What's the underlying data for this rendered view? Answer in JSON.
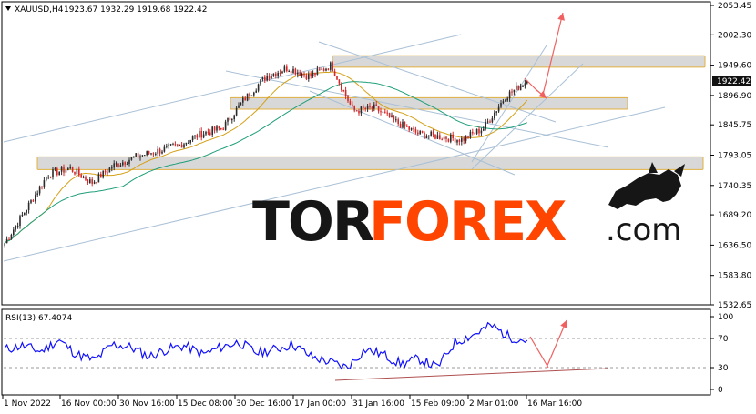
{
  "header": {
    "symbol_label": "XAUUSD,H4",
    "ohlc_text": "1923.67 1932.29 1919.68 1922.42"
  },
  "price_axis": {
    "ticks": [
      "2053.45",
      "2002.30",
      "1949.60",
      "1896.90",
      "1845.75",
      "1793.05",
      "1740.35",
      "1689.20",
      "1636.50",
      "1583.80",
      "1532.65"
    ],
    "current_price": "1922.42"
  },
  "rsi_panel": {
    "label": "RSI(13) 67.4074",
    "ticks": [
      "100",
      "70",
      "30",
      "0"
    ]
  },
  "time_axis": {
    "ticks": [
      "1 Nov 2022",
      "16 Nov 00:00",
      "30 Nov 16:00",
      "15 Dec 08:00",
      "30 Dec 16:00",
      "17 Jan 00:00",
      "31 Jan 16:00",
      "15 Feb 09:00",
      "2 Mar 01:00",
      "16 Mar 16:00"
    ]
  },
  "watermark": {
    "part1": "TOR",
    "part2": "FOREX",
    "part3": ".com"
  },
  "colors": {
    "bull_candle": "#2b2b2b",
    "bear_candle": "#d62728",
    "ma_fast": "#d4a017",
    "ma_slow": "#1f9e7a",
    "channel": "#a9c0d6",
    "zone_fill": "#d8d8d8",
    "zone_border": "#e0b040",
    "arrow": "#f06060",
    "rsi_line": "#1010ff",
    "rsi_level": "#9a9a9a",
    "current_price_bg": "#111111",
    "watermark_dark": "#161616",
    "watermark_orange": "#ff4500"
  },
  "chart_data": [
    {
      "type": "candlestick",
      "title": "XAUUSD,H4",
      "price_range": [
        1532.65,
        2053.45
      ],
      "ohlc_last": {
        "open": 1923.67,
        "high": 1932.29,
        "low": 1919.68,
        "close": 1922.42
      },
      "x": [
        "1 Nov 2022",
        "16 Nov 2022",
        "30 Nov 2022",
        "15 Dec 2022",
        "30 Dec 2022",
        "17 Jan 2023",
        "31 Jan 2023",
        "15 Feb 2023",
        "2 Mar 2023",
        "16 Mar 2023"
      ],
      "close_path": [
        1640,
        1700,
        1760,
        1770,
        1745,
        1775,
        1790,
        1800,
        1810,
        1830,
        1840,
        1890,
        1930,
        1945,
        1930,
        1950,
        1870,
        1875,
        1850,
        1830,
        1825,
        1820,
        1840,
        1895,
        1922.42
      ],
      "support_resistance_zones": [
        [
          1946,
          1966
        ],
        [
          1873,
          1893
        ],
        [
          1768,
          1790
        ]
      ]
    },
    {
      "type": "line",
      "title": "RSI(13)",
      "last_value": 67.4074,
      "ylim": [
        0,
        100
      ],
      "levels": [
        70,
        30
      ],
      "values": [
        55,
        60,
        52,
        68,
        48,
        40,
        62,
        58,
        45,
        55,
        60,
        48,
        58,
        65,
        50,
        55,
        62,
        45,
        38,
        30,
        55,
        48,
        35,
        42,
        30,
        65,
        75,
        88,
        72,
        67.4
      ]
    }
  ]
}
